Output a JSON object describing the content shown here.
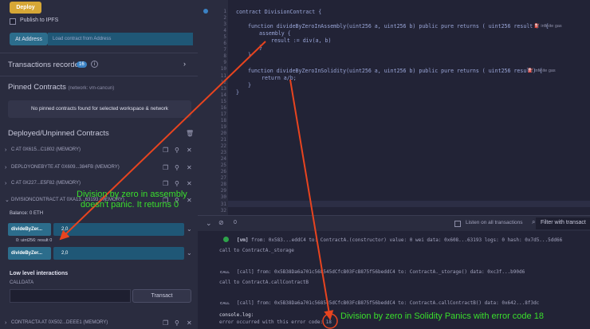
{
  "deploy": {
    "button": "Deploy",
    "publish_label": "Publish to IPFS",
    "at_address_button": "At Address",
    "address_placeholder": "Load contract from Address"
  },
  "transactions": {
    "label": "Transactions recorded",
    "count": "16"
  },
  "pinned": {
    "label": "Pinned Contracts",
    "network": "(network: vm-cancun)",
    "empty_text": "No pinned contracts found for selected workspace & network"
  },
  "deployed": {
    "label": "Deployed/Unpinned Contracts",
    "contracts": [
      "C AT 0X615...C1802 (MEMORY)",
      "DEPLOYONEBYTE AT 0X609...384FB (MEMORY)",
      "C AT 0X227...E5F82 (MEMORY)",
      "DIVISIONCONTRACT AT 0XA13...63193 (MEMORY)"
    ],
    "last_contract": "CONTRACTA AT 0X502...DEEE1 (MEMORY)",
    "balance": "Balance: 0 ETH",
    "functions": [
      {
        "name": "divideByZer...",
        "args": "2,0"
      },
      {
        "name": "divideByZer...",
        "args": "2,0"
      }
    ],
    "result": "0: uint256: result 0",
    "low_level": "Low level interactions",
    "calldata": "CALLDATA",
    "transact": "Transact"
  },
  "editor": {
    "line_numbers": [
      "1",
      "2",
      "3",
      "4",
      "5",
      "6",
      "7",
      "8",
      "9",
      "10",
      "11",
      "12",
      "13",
      "14",
      "15",
      "16",
      "17",
      "18",
      "19",
      "20",
      "21",
      "22",
      "23",
      "24",
      "25",
      "26",
      "27",
      "28",
      "29",
      "30",
      "31",
      "32"
    ],
    "code": {
      "l1": "contract DivisionContract {",
      "l3": "function divideByZeroInAssembly(uint256 a, uint256 b) public pure returns ( uint256 result )  {",
      "l4": "assembly {",
      "l5": "result := div(a, b)",
      "l6": "}",
      "l7": "}",
      "l9": "function divideByZeroInSolidity(uint256 a, uint256 b) public pure returns ( uint256 result) {",
      "l10": "return a/b;",
      "l11": "}",
      "l12": "}"
    },
    "gas_label": "infinite gas"
  },
  "terminal": {
    "count": "0",
    "listen_label": "Listen on all transactions",
    "filter_placeholder": "Filter with transact",
    "logs": [
      {
        "tag": "[vm]",
        "text": "from: 0x583...eddC4 to: ContractA.(constructor) value: 0 wei data: 0x608...63193 logs: 0 hash: 0x7d5...5dd66",
        "sub": "call to ContractA._storage"
      },
      {
        "tag": "CALL",
        "text": "[call] from: 0x5B38Da6a701c568545dCfcB03FcB875f56beddC4 to: ContractA._storage() data: 0xc3f...b90d6",
        "sub": "call to ContractA.callContractB"
      },
      {
        "tag": "CALL",
        "text": "[call] from: 0x5B38Da6a701c568545dCfcB03FcB875f56beddC4 to: ContractA.callContractB() data: 0x642...8f3dc",
        "sub": ""
      }
    ],
    "console_label": "console.log:",
    "error_text": "error occurred with this error code: 18"
  },
  "annotations": {
    "assembly_line1": "Division by zero in assembly",
    "assembly_line2": "doesn't panic. It returns 0",
    "solidity": "Division by zero in Solidity Panics with error code 18"
  },
  "colors": {
    "annotation": "#3adf2c",
    "arrow": "#e8441f",
    "deploy_button": "#d6a736",
    "function_button": "#2c6d8c"
  }
}
